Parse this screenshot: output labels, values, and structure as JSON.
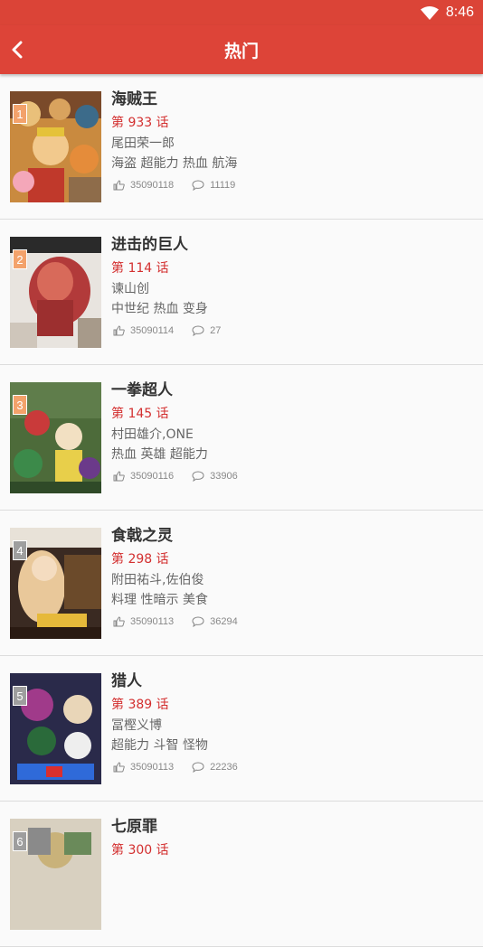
{
  "status_bar": {
    "time": "8:46"
  },
  "app_bar": {
    "title": "热门"
  },
  "comics": [
    {
      "rank": "1",
      "title": "海贼王",
      "chapter": "第 933 话",
      "author": "尾田荣一郎",
      "tags": "海盗 超能力 热血 航海",
      "likes": "35090118",
      "comments": "11119",
      "rank_color": "#f3a26b"
    },
    {
      "rank": "2",
      "title": "进击的巨人",
      "chapter": "第 114 话",
      "author": "谏山创",
      "tags": "中世纪 热血 变身",
      "likes": "35090114",
      "comments": "27",
      "rank_color": "#f3a26b"
    },
    {
      "rank": "3",
      "title": "一拳超人",
      "chapter": "第 145 话",
      "author": "村田雄介,ONE",
      "tags": "热血 英雄 超能力",
      "likes": "35090116",
      "comments": "33906",
      "rank_color": "#f3a26b"
    },
    {
      "rank": "4",
      "title": "食戟之灵",
      "chapter": "第 298 话",
      "author": "附田祐斗,佐伯俊",
      "tags": "料理 性暗示 美食",
      "likes": "35090113",
      "comments": "36294",
      "rank_color": "#9e9e9e"
    },
    {
      "rank": "5",
      "title": "猎人",
      "chapter": "第 389 话",
      "author": "冨樫义博",
      "tags": "超能力 斗智 怪物",
      "likes": "35090113",
      "comments": "22236",
      "rank_color": "#9e9e9e"
    },
    {
      "rank": "6",
      "title": "七原罪",
      "chapter": "第 300 话",
      "author": "",
      "tags": "",
      "likes": "",
      "comments": "",
      "rank_color": "#9e9e9e"
    }
  ],
  "colors": {
    "primary": "#dd4438",
    "chapter_red": "#d32f2f"
  }
}
